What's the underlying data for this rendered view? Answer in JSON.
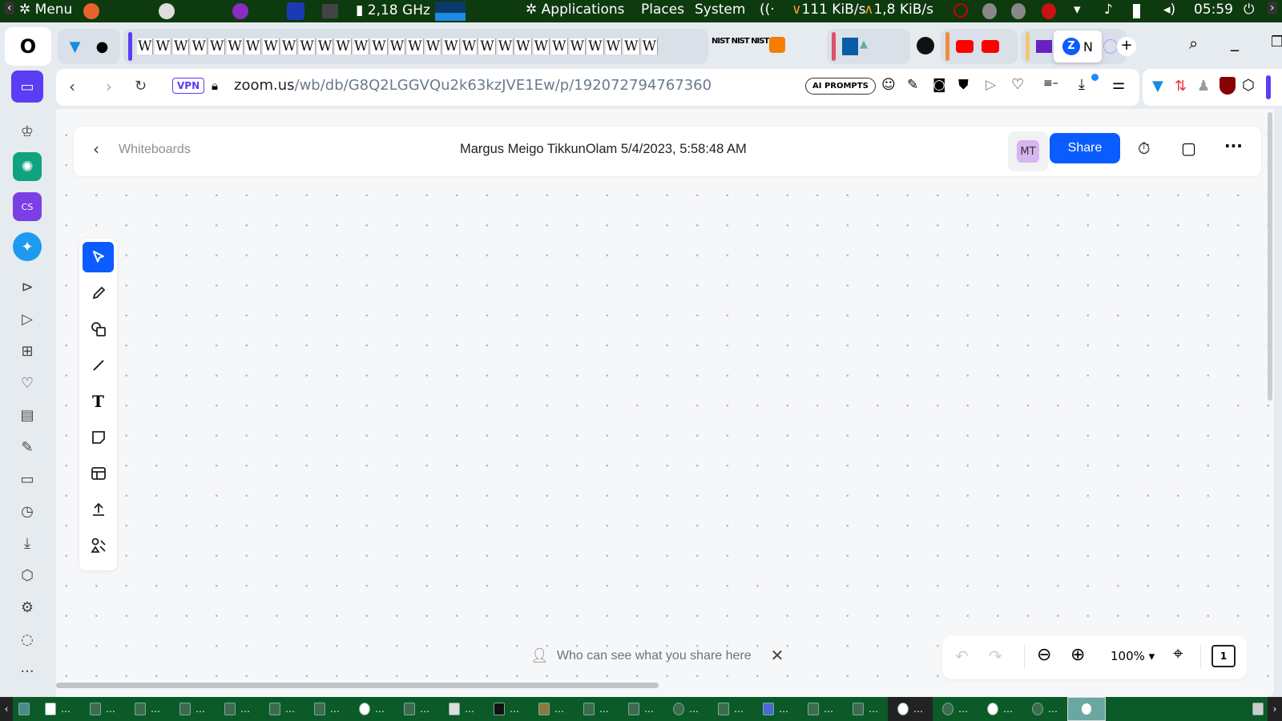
{
  "top_panel": {
    "menu": "Menu",
    "cpu": "2,18 GHz",
    "applications": "Applications",
    "places": "Places",
    "system": "System",
    "net_down": "111 KiB/s",
    "net_up": "1,8 KiB/s",
    "clock": "05:59"
  },
  "tabs": {
    "active_tab_partial": "N",
    "new_tab_icon": "plus-icon"
  },
  "address_bar": {
    "vpn": "VPN",
    "url_host": "zoom.us",
    "url_path": "/wb/db/G8Q2LGGVQu2k63kzJVE1Ew/p/192072794767360",
    "ai_prompts": "AI PROMPTS"
  },
  "header": {
    "back_label": "Whiteboards",
    "title": "Margus Meigo TikkunOlam 5/4/2023, 5:58:48 AM",
    "avatar_initials": "MT",
    "share": "Share"
  },
  "tools": [
    "select",
    "pen",
    "shapes",
    "line",
    "text",
    "sticky-note",
    "template",
    "upload",
    "smart-recognition"
  ],
  "notice": {
    "text": "Who can see what you share here"
  },
  "zoom": {
    "level": "100%",
    "pages": "1"
  },
  "colors": {
    "accent": "#0b5cff",
    "panel": "#0e3a10",
    "taskbar": "#0b5a28",
    "opera_purple": "#5a3df5"
  }
}
